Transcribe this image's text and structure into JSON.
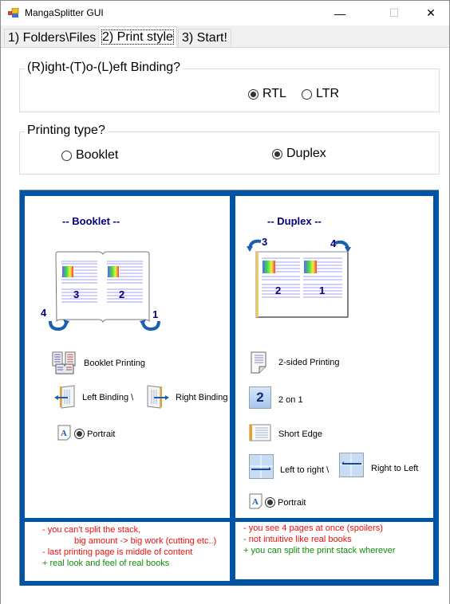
{
  "window": {
    "title": "MangaSplitter GUI",
    "controls": {
      "minimize": "—",
      "maximize": "☐",
      "close": "✕"
    }
  },
  "tabs": [
    {
      "label": "1) Folders\\Files",
      "active": false
    },
    {
      "label": "2) Print style",
      "active": true
    },
    {
      "label": "3) Start!",
      "active": false
    }
  ],
  "binding_group": {
    "label": "(R)ight-(T)o-(L)eft Binding?",
    "options": [
      {
        "label": "RTL",
        "selected": true
      },
      {
        "label": "LTR",
        "selected": false
      }
    ]
  },
  "printing_group": {
    "label": "Printing type?",
    "options": [
      {
        "label": "Booklet",
        "selected": false
      },
      {
        "label": "Duplex",
        "selected": true
      }
    ]
  },
  "booklet": {
    "heading": "-- Booklet --",
    "page_numbers": {
      "left_page": "3",
      "right_page": "2",
      "back_left": "4",
      "front_right": "1"
    },
    "settings": {
      "printing": "Booklet Printing",
      "left_binding": "Left Binding \\",
      "right_binding": "Right Binding",
      "orientation": "Portrait"
    },
    "notes": [
      {
        "text": "- you can't split the stack,",
        "type": "con"
      },
      {
        "text": "big amount -> big work (cutting etc..)",
        "type": "con"
      },
      {
        "text": "- last printing page is middle of content",
        "type": "con"
      },
      {
        "text": "+ real look and feel of real books",
        "type": "pro"
      }
    ]
  },
  "duplex": {
    "heading": "-- Duplex --",
    "page_numbers": {
      "left_page": "2",
      "right_page": "1",
      "back_left": "3",
      "back_right": "4"
    },
    "settings": {
      "printing": "2-sided Printing",
      "pages_per_sheet": "2 on 1",
      "pages_icon_number": "2",
      "flip": "Short Edge",
      "left_to_right": "Left to right \\",
      "right_to_left": "Right to Left",
      "orientation": "Portrait"
    },
    "notes": [
      {
        "text": "- you see 4 pages at once (spoilers)",
        "type": "con"
      },
      {
        "text": "- not intuitive like real books",
        "type": "con"
      },
      {
        "text": "+ you can split the print stack wherever",
        "type": "pro"
      }
    ]
  },
  "colors": {
    "frame_blue": "#0054a6",
    "heading_navy": "#000080",
    "con_red": "#e81010",
    "pro_green": "#108a10"
  }
}
